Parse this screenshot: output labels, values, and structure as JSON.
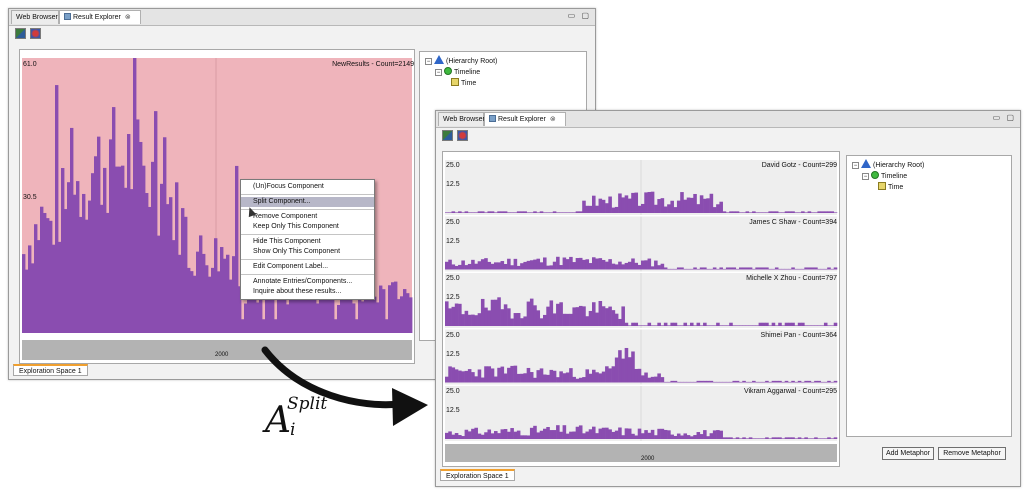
{
  "window1": {
    "tabs": [
      {
        "label": "Web Browser"
      },
      {
        "label": "Result Explorer",
        "close": "⊗"
      }
    ],
    "window_controls": "▭ ▢",
    "toolbar": {
      "icons": [
        "split-view-icon",
        "metaphor-icon"
      ]
    },
    "chart": {
      "y_max_label": "61.0",
      "y_mid_label": "30.5",
      "title": "NewResults - Count=2149",
      "axis_label": "2000",
      "colors": {
        "background": "#efb4bb",
        "bars": "#8a4db0",
        "axis": "#b3b3b3"
      }
    },
    "tree": [
      {
        "label": "(Hierarchy Root)",
        "icon": "triangle-icon",
        "depth": 0,
        "expander": "⊟"
      },
      {
        "label": "Timeline",
        "icon": "circle-icon",
        "depth": 1,
        "expander": "⊟"
      },
      {
        "label": "Time",
        "icon": "book-icon",
        "depth": 2,
        "expander": ""
      }
    ],
    "bottom_tab": "Exploration Space 1",
    "context_menu": [
      {
        "label": "(Un)Focus Component"
      },
      {
        "sep": true
      },
      {
        "label": "Split Component...",
        "selected": true
      },
      {
        "sep": true
      },
      {
        "label": "Remove Component"
      },
      {
        "label": "Keep Only This Component"
      },
      {
        "sep": true
      },
      {
        "label": "Hide This Component"
      },
      {
        "label": "Show Only This Component"
      },
      {
        "sep": true
      },
      {
        "label": "Edit Component Label..."
      },
      {
        "sep": true
      },
      {
        "label": "Annotate Entries/Components..."
      },
      {
        "label": "Inquire about these results..."
      }
    ]
  },
  "window2": {
    "tabs": [
      {
        "label": "Web Browser"
      },
      {
        "label": "Result Explorer",
        "close": "⊗"
      }
    ],
    "window_controls": "▭ ▢",
    "toolbar": {
      "icons": [
        "split-view-icon",
        "metaphor-icon"
      ]
    },
    "axis_label": "2000",
    "panels": [
      {
        "title": "David Gotz - Count=299",
        "ymax": "25.0",
        "ymid": "12.5"
      },
      {
        "title": "James C Shaw - Count=394",
        "ymax": "25.0",
        "ymid": "12.5"
      },
      {
        "title": "Michelle X Zhou - Count=797",
        "ymax": "25.0",
        "ymid": "12.5"
      },
      {
        "title": "Shimei Pan - Count=364",
        "ymax": "25.0",
        "ymid": "12.5"
      },
      {
        "title": "Vikram Aggarwal - Count=295",
        "ymax": "25.0",
        "ymid": "12.5"
      }
    ],
    "tree": [
      {
        "label": "(Hierarchy Root)",
        "icon": "triangle-icon",
        "depth": 0,
        "expander": "⊟"
      },
      {
        "label": "Timeline",
        "icon": "circle-icon",
        "depth": 1,
        "expander": "⊟"
      },
      {
        "label": "Time",
        "icon": "book-icon",
        "depth": 2,
        "expander": ""
      }
    ],
    "buttons": {
      "add_metaphor": "Add Metaphor",
      "remove_metaphor": "Remove Metaphor"
    },
    "bottom_tab": "Exploration Space 1"
  },
  "annotation": {
    "base": "A",
    "superscript": "Split",
    "subscript": "i"
  },
  "colors": {
    "bar": "#8a4db0",
    "panel_bg": "#eeeeee",
    "arrow": "#111111"
  }
}
